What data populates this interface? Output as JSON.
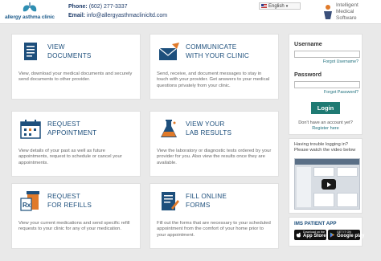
{
  "header": {
    "logo_text": "allergy asthma clinic",
    "phone_label": "Phone:",
    "phone": "(602) 277-3337",
    "email_label": "Email:",
    "email": "info@allergyasthmaclinicltd.com",
    "language": "English",
    "vendor_line1": "Intelligent",
    "vendor_line2": "Medical",
    "vendor_line3": "Software"
  },
  "cards": [
    {
      "title1": "VIEW",
      "title2": "DOCUMENTS",
      "icon": "document-icon",
      "desc": "View, download your medical documents and securely send documents to other provider."
    },
    {
      "title1": "COMMUNICATE",
      "title2": "WITH YOUR CLINIC",
      "icon": "envelope-icon",
      "desc": "Send, receive, and document messages to stay in touch with your provider. Get answers to your medical questions privately from your clinic."
    },
    {
      "title1": "REQUEST",
      "title2": "APPOINTMENT",
      "icon": "calendar-icon",
      "desc": "View details of your past as well as future appointments, request to schedule or cancel your appointments."
    },
    {
      "title1": "VIEW YOUR",
      "title2": "LAB RESULTS",
      "icon": "flask-icon",
      "desc": "View the laboratory or diagnostic tests ordered by your provider for you. Also view the results once they are available."
    },
    {
      "title1": "REQUEST",
      "title2": "FOR REFILLS",
      "icon": "prescription-icon",
      "desc": "View your current medications and send specific refill requests to your clinic for any of your medication."
    },
    {
      "title1": "FILL ONLINE",
      "title2": "FORMS",
      "icon": "form-icon",
      "desc": "Fill out the forms that are necessary to your scheduled appointment from the comfort of your home prior to your appointment."
    }
  ],
  "login": {
    "username_label": "Username",
    "forgot_username": "Forgot Username?",
    "password_label": "Password",
    "forgot_password": "Forgot Password?",
    "login_button": "Login",
    "no_account": "Don't have an account yet?",
    "register": "Register here"
  },
  "help": {
    "text": "Having trouble logging in? Please watch the video below"
  },
  "app": {
    "title": "IMS PATIENT APP",
    "appstore_small": "Download on the",
    "appstore_big": "App Store",
    "googleplay_small": "GET IT ON",
    "googleplay_big": "Google play"
  },
  "colors": {
    "accent": "#1f7a73",
    "title_blue": "#1d4f7c",
    "background": "#e9e9e9"
  }
}
